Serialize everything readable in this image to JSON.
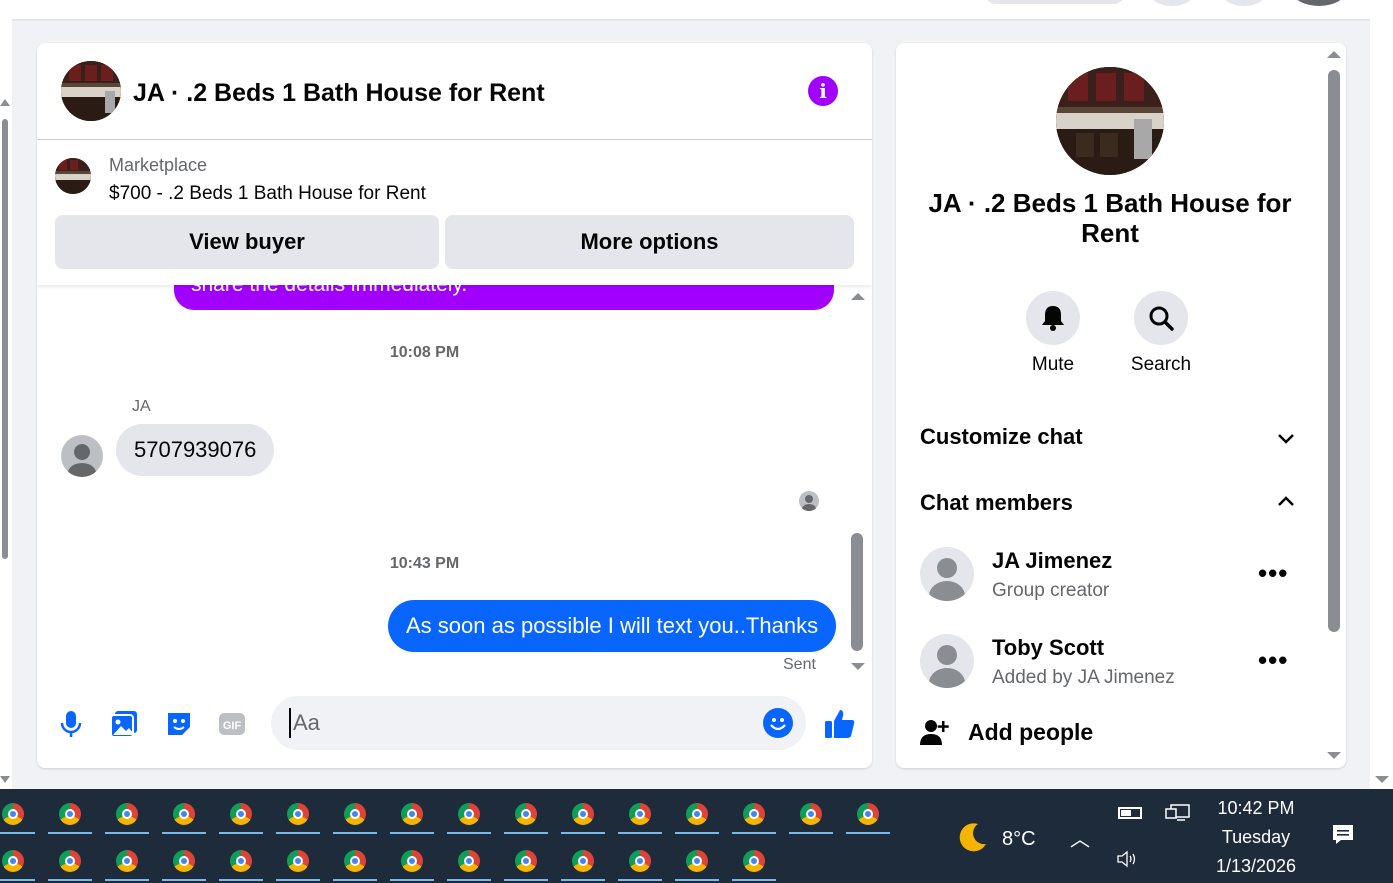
{
  "chat": {
    "title": "JA · .2 Beds 1 Bath House for Rent",
    "info_icon": "info-icon",
    "marketplace": {
      "label": "Marketplace",
      "listing": "$700 - .2 Beds 1 Bath House for Rent",
      "view_buyer": "View buyer",
      "more_options": "More options"
    },
    "messages": {
      "partial_text": "share the details immediately.",
      "time1": "10:08 PM",
      "sender": "JA",
      "incoming": "5707939076",
      "time2": "10:43 PM",
      "outgoing": "As soon as possible I will text you..Thanks",
      "status": "Sent"
    },
    "composer": {
      "placeholder": "Aa",
      "tools": [
        "microphone-icon",
        "photo-icon",
        "sticker-icon",
        "gif-icon"
      ],
      "gif_label": "GIF"
    }
  },
  "info_panel": {
    "title": "JA · .2 Beds 1 Bath House for Rent",
    "mute_label": "Mute",
    "search_label": "Search",
    "customize_chat": "Customize chat",
    "chat_members": "Chat members",
    "members": [
      {
        "name": "JA Jimenez",
        "subtitle": "Group creator"
      },
      {
        "name": "Toby Scott",
        "subtitle": "Added by JA Jimenez"
      }
    ],
    "add_people": "Add people"
  },
  "taskbar": {
    "temperature": "8°C",
    "time": "10:42 PM",
    "day": "Tuesday",
    "date": "1/13/2026"
  },
  "colors": {
    "accent_purple": "#a100ff",
    "outgoing_blue": "#0866ff",
    "taskbar_bg": "#1d2b3a"
  }
}
